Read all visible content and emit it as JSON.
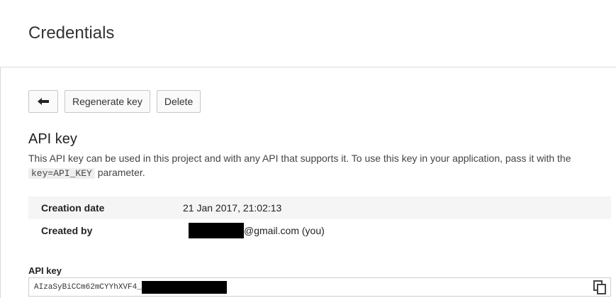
{
  "header": {
    "title": "Credentials"
  },
  "toolbar": {
    "back_icon": "back-arrow-icon",
    "regenerate_label": "Regenerate key",
    "delete_label": "Delete"
  },
  "section": {
    "title": "API key",
    "description_part1": "This API key can be used in this project and with any API that supports it. To use this key in your application, pass it with the ",
    "description_code": "key=API_KEY",
    "description_part2": " parameter."
  },
  "details": {
    "creation_date_label": "Creation date",
    "creation_date_value": "21 Jan 2017, 21:02:13",
    "created_by_label": "Created by",
    "created_by_value": "@gmail.com (you)"
  },
  "api_key": {
    "label": "API key",
    "value": "AIzaSyBiCCm62mCYYhXVF4_",
    "copy_icon": "copy-icon"
  },
  "colors": {
    "redaction": "#000000",
    "row_shade": "#f5f5f5"
  }
}
